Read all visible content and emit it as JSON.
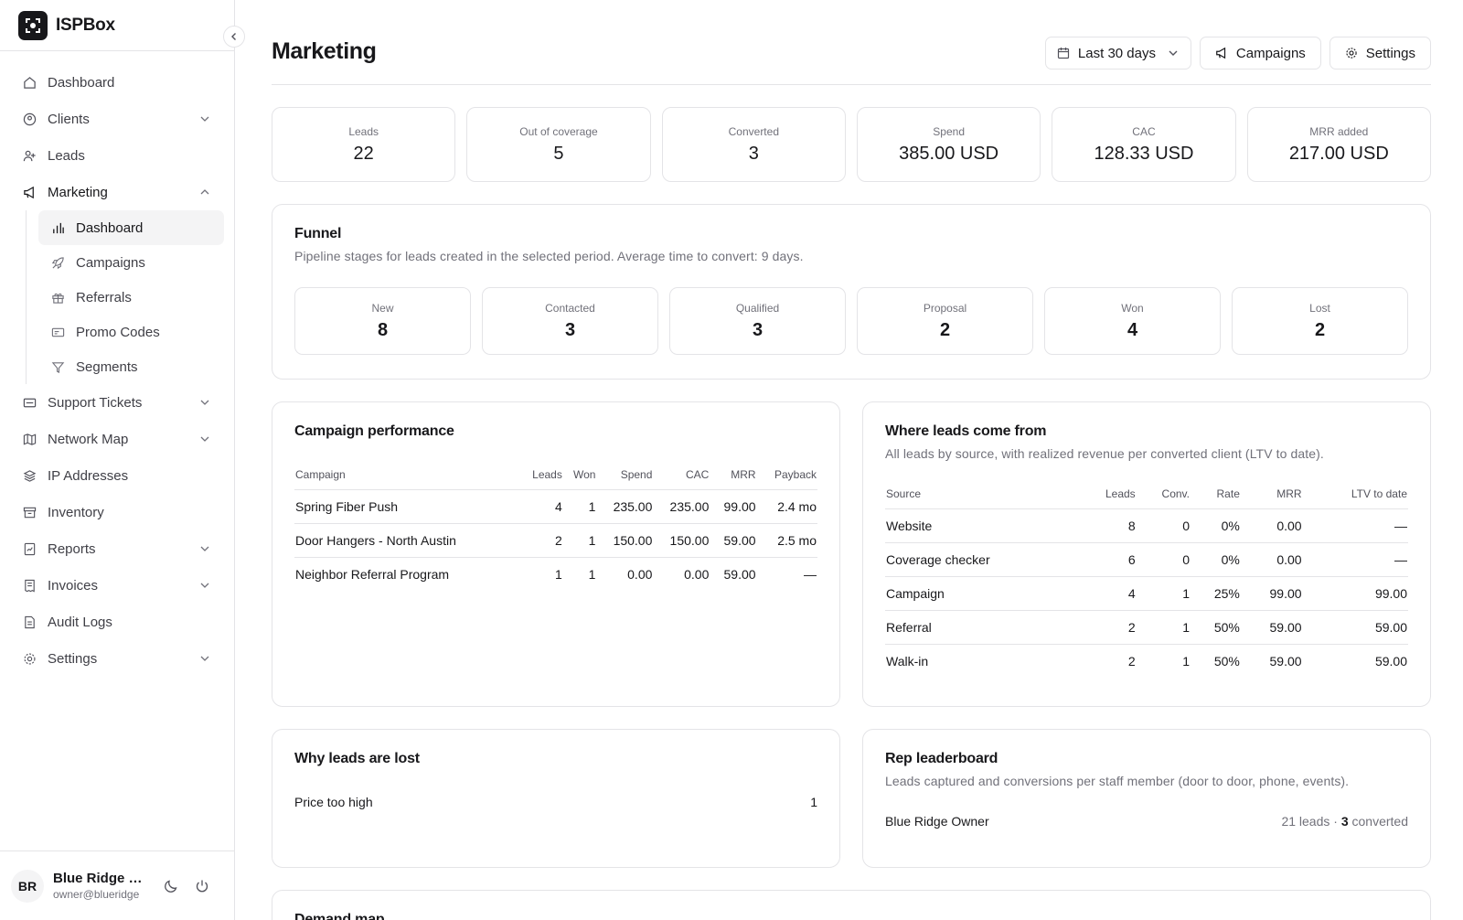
{
  "app": {
    "name": "ISPBox"
  },
  "sidebar": {
    "items": [
      {
        "label": "Dashboard"
      },
      {
        "label": "Clients"
      },
      {
        "label": "Leads"
      },
      {
        "label": "Marketing"
      },
      {
        "label": "Support Tickets"
      },
      {
        "label": "Network Map"
      },
      {
        "label": "IP Addresses"
      },
      {
        "label": "Inventory"
      },
      {
        "label": "Reports"
      },
      {
        "label": "Invoices"
      },
      {
        "label": "Audit Logs"
      },
      {
        "label": "Settings"
      }
    ],
    "marketing_sub": [
      {
        "label": "Dashboard"
      },
      {
        "label": "Campaigns"
      },
      {
        "label": "Referrals"
      },
      {
        "label": "Promo Codes"
      },
      {
        "label": "Segments"
      }
    ]
  },
  "user": {
    "initials": "BR",
    "name": "Blue Ridge Owner",
    "email": "owner@blueridge"
  },
  "header": {
    "title": "Marketing",
    "range": "Last 30 days",
    "campaigns_label": "Campaigns",
    "settings_label": "Settings"
  },
  "stats": [
    {
      "label": "Leads",
      "value": "22"
    },
    {
      "label": "Out of coverage",
      "value": "5"
    },
    {
      "label": "Converted",
      "value": "3"
    },
    {
      "label": "Spend",
      "value": "385.00 USD"
    },
    {
      "label": "CAC",
      "value": "128.33 USD"
    },
    {
      "label": "MRR added",
      "value": "217.00 USD"
    }
  ],
  "funnel": {
    "title": "Funnel",
    "subtitle": "Pipeline stages for leads created in the selected period. Average time to convert: 9 days.",
    "stages": [
      {
        "label": "New",
        "value": "8"
      },
      {
        "label": "Contacted",
        "value": "3"
      },
      {
        "label": "Qualified",
        "value": "3"
      },
      {
        "label": "Proposal",
        "value": "2"
      },
      {
        "label": "Won",
        "value": "4"
      },
      {
        "label": "Lost",
        "value": "2"
      }
    ]
  },
  "campaign_performance": {
    "title": "Campaign performance",
    "columns": [
      "Campaign",
      "Leads",
      "Won",
      "Spend",
      "CAC",
      "MRR",
      "Payback"
    ],
    "rows": [
      [
        "Spring Fiber Push",
        "4",
        "1",
        "235.00",
        "235.00",
        "99.00",
        "2.4 mo"
      ],
      [
        "Door Hangers - North Austin",
        "2",
        "1",
        "150.00",
        "150.00",
        "59.00",
        "2.5 mo"
      ],
      [
        "Neighbor Referral Program",
        "1",
        "1",
        "0.00",
        "0.00",
        "59.00",
        "—"
      ]
    ]
  },
  "sources": {
    "title": "Where leads come from",
    "subtitle": "All leads by source, with realized revenue per converted client (LTV to date).",
    "columns": [
      "Source",
      "Leads",
      "Conv.",
      "Rate",
      "MRR",
      "LTV to date"
    ],
    "rows": [
      [
        "Website",
        "8",
        "0",
        "0%",
        "0.00",
        "—"
      ],
      [
        "Coverage checker",
        "6",
        "0",
        "0%",
        "0.00",
        "—"
      ],
      [
        "Campaign",
        "4",
        "1",
        "25%",
        "99.00",
        "99.00"
      ],
      [
        "Referral",
        "2",
        "1",
        "50%",
        "59.00",
        "59.00"
      ],
      [
        "Walk-in",
        "2",
        "1",
        "50%",
        "59.00",
        "59.00"
      ]
    ]
  },
  "lost_reasons": {
    "title": "Why leads are lost",
    "rows": [
      {
        "reason": "Price too high",
        "count": "1"
      }
    ]
  },
  "leaderboard": {
    "title": "Rep leaderboard",
    "subtitle": "Leads captured and conversions per staff member (door to door, phone, events).",
    "rows": [
      {
        "name": "Blue Ridge Owner",
        "leads": "21 leads",
        "sep": " · ",
        "converted": "3",
        "converted_suffix": " converted"
      }
    ]
  },
  "demand_map": {
    "title": "Demand map"
  }
}
